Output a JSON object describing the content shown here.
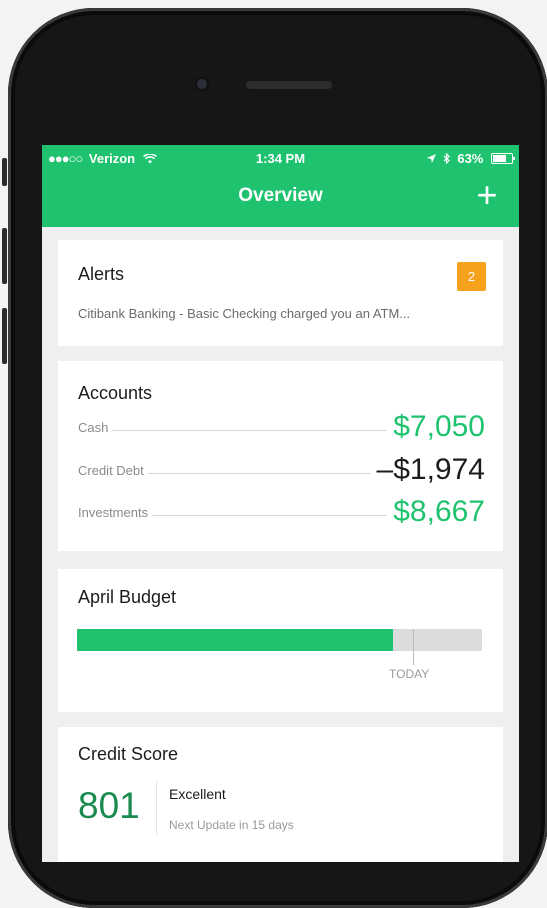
{
  "status_bar": {
    "carrier": "Verizon",
    "time": "1:34 PM",
    "battery": "63%"
  },
  "nav": {
    "title": "Overview",
    "add_label": "+"
  },
  "alerts": {
    "title": "Alerts",
    "badge": "2",
    "text": "Citibank Banking - Basic Checking charged you an ATM..."
  },
  "accounts": {
    "title": "Accounts",
    "rows": [
      {
        "label": "Cash",
        "amount": "$7,050"
      },
      {
        "label": "Credit Debt",
        "amount": "–$1,974"
      },
      {
        "label": "Investments",
        "amount": "$8,667"
      }
    ]
  },
  "budget": {
    "title": "April Budget",
    "spent_fraction": 0.78,
    "today_fraction": 0.83,
    "today_label": "TODAY"
  },
  "credit_score": {
    "title": "Credit Score",
    "score": "801",
    "rating": "Excellent",
    "next_update": "Next Update in 15 days"
  },
  "colors": {
    "brand_green": "#1fc36f",
    "alert_orange": "#f6a21c",
    "score_green": "#1a8a4f"
  }
}
